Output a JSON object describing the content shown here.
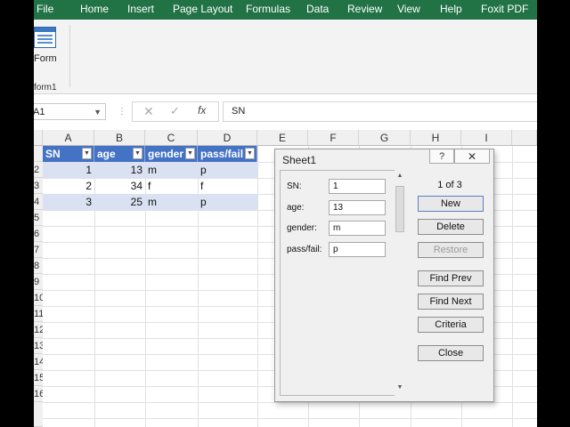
{
  "menu": [
    "File",
    "Home",
    "Insert",
    "Page Layout",
    "Formulas",
    "Data",
    "Review",
    "View",
    "Help",
    "Foxit PDF"
  ],
  "ribbon": {
    "form_label": "Form",
    "group_label": "form1"
  },
  "formula_bar": {
    "name_box": "A1",
    "fx": "fx",
    "content": "SN"
  },
  "columns": [
    "A",
    "B",
    "C",
    "D",
    "E",
    "F",
    "G",
    "H",
    "I"
  ],
  "rows": [
    "2",
    "3",
    "4",
    "5",
    "6",
    "7",
    "8",
    "9",
    "10",
    "11",
    "12",
    "13",
    "14",
    "15",
    "16"
  ],
  "table": {
    "headers": [
      "SN",
      "age",
      "gender",
      "pass/fail"
    ],
    "rows": [
      [
        "1",
        "13",
        "m",
        "p"
      ],
      [
        "2",
        "34",
        "f",
        "f"
      ],
      [
        "3",
        "25",
        "m",
        "p"
      ]
    ]
  },
  "dialog": {
    "title": "Sheet1",
    "help": "?",
    "close": "✕",
    "fields": [
      {
        "label": "SN:",
        "value": "1"
      },
      {
        "label": "age:",
        "value": "13"
      },
      {
        "label": "gender:",
        "value": "m"
      },
      {
        "label": "pass/fail:",
        "value": "p"
      }
    ],
    "record": "1 of 3",
    "buttons": [
      "New",
      "Delete",
      "Restore",
      "Find Prev",
      "Find Next",
      "Criteria",
      "Close"
    ]
  },
  "colors": {
    "excel_green": "#217346",
    "table_header": "#4472c4",
    "band": "#d9e1f2"
  }
}
